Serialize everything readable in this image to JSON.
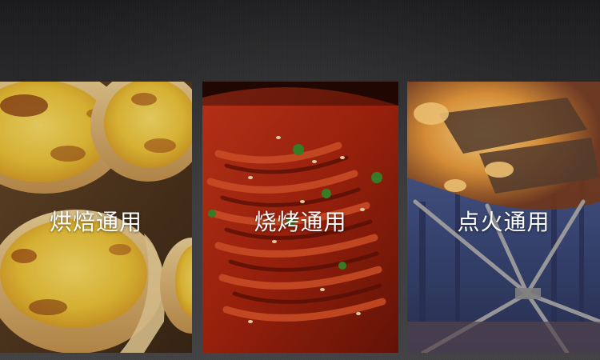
{
  "panels": [
    {
      "label": "烘焙通用",
      "image": "egg-tart-photo"
    },
    {
      "label": "烧烤通用",
      "image": "grilled-fish-photo"
    },
    {
      "label": "点火通用",
      "image": "campfire-stand-photo"
    }
  ],
  "colors": {
    "background_top": "#1b1b1d",
    "background_bottom": "#434346",
    "label_text": "#ffffff"
  }
}
